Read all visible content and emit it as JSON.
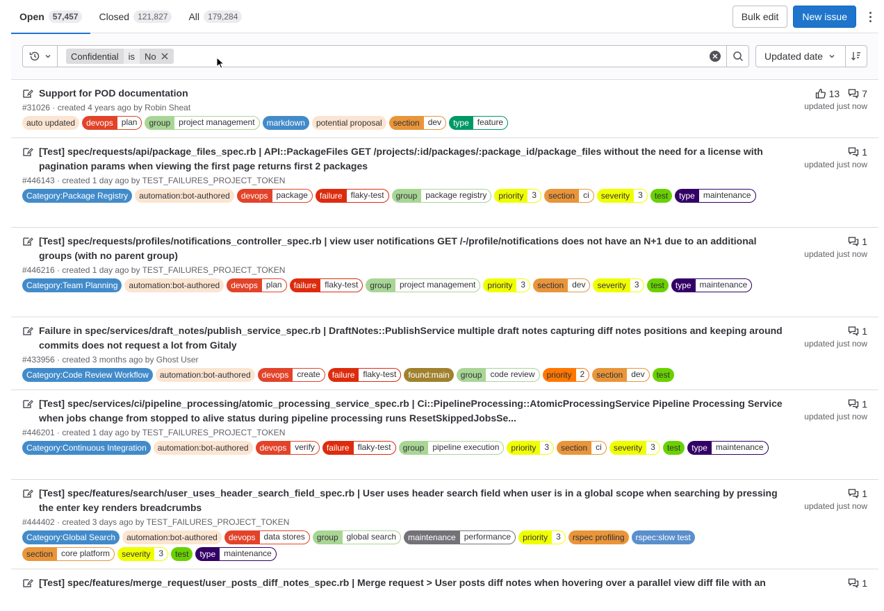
{
  "tabs": [
    {
      "label": "Open",
      "count": "57,457"
    },
    {
      "label": "Closed",
      "count": "121,827"
    },
    {
      "label": "All",
      "count": "179,284"
    }
  ],
  "actions": {
    "bulk_edit": "Bulk edit",
    "new_issue": "New issue"
  },
  "filter": {
    "token_key": "Confidential",
    "token_op": "is",
    "token_value": "No"
  },
  "sort": {
    "label": "Updated date"
  },
  "colors": {
    "accent": "#1f75cb"
  },
  "issues": [
    {
      "title": "Support for POD documentation",
      "meta": "#31026 · created 4 years ago by Robin Sheat",
      "upvotes": "13",
      "comments": "7",
      "updated": "updated just now",
      "labels": [
        {
          "text": "auto updated",
          "bg": "#fbe5d1",
          "fg": "#333238"
        },
        {
          "key": "devops",
          "value": "plan",
          "bg": "#e24329",
          "fg": "#fff"
        },
        {
          "key": "group",
          "value": "project management",
          "bg": "#a8d695",
          "fg": "#333238"
        },
        {
          "text": "markdown",
          "bg": "#428bca",
          "fg": "#fff"
        },
        {
          "text": "potential proposal",
          "bg": "#fbe5d1",
          "fg": "#333238"
        },
        {
          "key": "section",
          "value": "dev",
          "bg": "#e9953a",
          "fg": "#333238"
        },
        {
          "key": "type",
          "value": "feature",
          "bg": "#009966",
          "fg": "#fff"
        }
      ]
    },
    {
      "title": "[Test] spec/requests/api/package_files_spec.rb | API::PackageFiles GET /projects/:id/packages/:package_id/package_files without the need for a license with pagination params when viewing the first page returns first 2 packages",
      "meta": "#446143 · created 1 day ago by TEST_FAILURES_PROJECT_TOKEN",
      "comments": "1",
      "updated": "updated just now",
      "labels": [
        {
          "text": "Category:Package Registry",
          "bg": "#428bca",
          "fg": "#fff"
        },
        {
          "text": "automation:bot-authored",
          "bg": "#fbe5d1",
          "fg": "#333238"
        },
        {
          "key": "devops",
          "value": "package",
          "bg": "#e24329",
          "fg": "#fff"
        },
        {
          "key": "failure",
          "value": "flaky-test",
          "bg": "#dd2b0e",
          "fg": "#fff"
        },
        {
          "key": "group",
          "value": "package registry",
          "bg": "#a8d695",
          "fg": "#333238"
        },
        {
          "key": "priority",
          "value": "3",
          "bg": "#f0ff00",
          "fg": "#333238"
        },
        {
          "key": "section",
          "value": "ci",
          "bg": "#e9953a",
          "fg": "#333238"
        },
        {
          "key": "severity",
          "value": "3",
          "bg": "#f0ff00",
          "fg": "#333238"
        },
        {
          "text": "test",
          "bg": "#69d100",
          "fg": "#333238"
        },
        {
          "key": "type",
          "value": "maintenance",
          "bg": "#330066",
          "fg": "#fff"
        }
      ]
    },
    {
      "title": "[Test] spec/requests/profiles/notifications_controller_spec.rb | view user notifications GET /-/profile/notifications does not have an N+1 due to an additional groups (with no parent group)",
      "meta": "#446216 · created 1 day ago by TEST_FAILURES_PROJECT_TOKEN",
      "comments": "1",
      "updated": "updated just now",
      "labels": [
        {
          "text": "Category:Team Planning",
          "bg": "#428bca",
          "fg": "#fff"
        },
        {
          "text": "automation:bot-authored",
          "bg": "#fbe5d1",
          "fg": "#333238"
        },
        {
          "key": "devops",
          "value": "plan",
          "bg": "#e24329",
          "fg": "#fff"
        },
        {
          "key": "failure",
          "value": "flaky-test",
          "bg": "#dd2b0e",
          "fg": "#fff"
        },
        {
          "key": "group",
          "value": "project management",
          "bg": "#a8d695",
          "fg": "#333238"
        },
        {
          "key": "priority",
          "value": "3",
          "bg": "#f0ff00",
          "fg": "#333238"
        },
        {
          "key": "section",
          "value": "dev",
          "bg": "#e9953a",
          "fg": "#333238"
        },
        {
          "key": "severity",
          "value": "3",
          "bg": "#f0ff00",
          "fg": "#333238"
        },
        {
          "text": "test",
          "bg": "#69d100",
          "fg": "#333238"
        },
        {
          "key": "type",
          "value": "maintenance",
          "bg": "#330066",
          "fg": "#fff"
        }
      ]
    },
    {
      "title": "Failure in spec/services/draft_notes/publish_service_spec.rb | DraftNotes::PublishService multiple draft notes capturing diff notes positions and keeping around commits does not request a lot from Gitaly",
      "meta": "#433956 · created 3 months ago by Ghost User",
      "comments": "1",
      "updated": "updated just now",
      "labels": [
        {
          "text": "Category:Code Review Workflow",
          "bg": "#428bca",
          "fg": "#fff"
        },
        {
          "text": "automation:bot-authored",
          "bg": "#fbe5d1",
          "fg": "#333238"
        },
        {
          "key": "devops",
          "value": "create",
          "bg": "#e24329",
          "fg": "#fff"
        },
        {
          "key": "failure",
          "value": "flaky-test",
          "bg": "#dd2b0e",
          "fg": "#fff"
        },
        {
          "text": "found:main",
          "bg": "#a0812e",
          "fg": "#fff"
        },
        {
          "key": "group",
          "value": "code review",
          "bg": "#a8d695",
          "fg": "#333238"
        },
        {
          "key": "priority",
          "value": "2",
          "bg": "#ff7700",
          "fg": "#333238"
        },
        {
          "key": "section",
          "value": "dev",
          "bg": "#e9953a",
          "fg": "#333238"
        },
        {
          "text": "test",
          "bg": "#69d100",
          "fg": "#333238"
        }
      ]
    },
    {
      "title": "[Test] spec/services/ci/pipeline_processing/atomic_processing_service_spec.rb | Ci::PipelineProcessing::AtomicProcessingService Pipeline Processing Service when jobs change from stopped to alive status during pipeline processing runs ResetSkippedJobsSe...",
      "meta": "#446201 · created 1 day ago by TEST_FAILURES_PROJECT_TOKEN",
      "comments": "1",
      "updated": "updated just now",
      "labels": [
        {
          "text": "Category:Continuous Integration",
          "bg": "#428bca",
          "fg": "#fff"
        },
        {
          "text": "automation:bot-authored",
          "bg": "#fbe5d1",
          "fg": "#333238"
        },
        {
          "key": "devops",
          "value": "verify",
          "bg": "#e24329",
          "fg": "#fff"
        },
        {
          "key": "failure",
          "value": "flaky-test",
          "bg": "#dd2b0e",
          "fg": "#fff"
        },
        {
          "key": "group",
          "value": "pipeline execution",
          "bg": "#a8d695",
          "fg": "#333238"
        },
        {
          "key": "priority",
          "value": "3",
          "bg": "#f0ff00",
          "fg": "#333238"
        },
        {
          "key": "section",
          "value": "ci",
          "bg": "#e9953a",
          "fg": "#333238"
        },
        {
          "key": "severity",
          "value": "3",
          "bg": "#f0ff00",
          "fg": "#333238"
        },
        {
          "text": "test",
          "bg": "#69d100",
          "fg": "#333238"
        },
        {
          "key": "type",
          "value": "maintenance",
          "bg": "#330066",
          "fg": "#fff"
        }
      ]
    },
    {
      "title": "[Test] spec/features/search/user_uses_header_search_field_spec.rb | User uses header search field when user is in a global scope when searching by pressing the enter key renders breadcrumbs",
      "meta": "#444402 · created 3 days ago by TEST_FAILURES_PROJECT_TOKEN",
      "comments": "1",
      "updated": "updated just now",
      "labels": [
        {
          "text": "Category:Global Search",
          "bg": "#428bca",
          "fg": "#fff"
        },
        {
          "text": "automation:bot-authored",
          "bg": "#fbe5d1",
          "fg": "#333238"
        },
        {
          "key": "devops",
          "value": "data stores",
          "bg": "#e24329",
          "fg": "#fff"
        },
        {
          "key": "group",
          "value": "global search",
          "bg": "#a8d695",
          "fg": "#333238"
        },
        {
          "key": "maintenance",
          "value": "performance",
          "bg": "#737278",
          "fg": "#fff"
        },
        {
          "key": "priority",
          "value": "3",
          "bg": "#f0ff00",
          "fg": "#333238"
        },
        {
          "text": "rspec profiling",
          "bg": "#e9953a",
          "fg": "#333238"
        },
        {
          "text": "rspec:slow test",
          "bg": "#5a8fcc",
          "fg": "#fff"
        },
        {
          "key": "section",
          "value": "core platform",
          "bg": "#e9953a",
          "fg": "#333238"
        },
        {
          "key": "severity",
          "value": "3",
          "bg": "#f0ff00",
          "fg": "#333238"
        },
        {
          "text": "test",
          "bg": "#69d100",
          "fg": "#333238"
        },
        {
          "key": "type",
          "value": "maintenance",
          "bg": "#330066",
          "fg": "#fff"
        }
      ]
    },
    {
      "title": "[Test] spec/features/merge_request/user_posts_diff_notes_spec.rb | Merge request > User posts diff notes when hovering over a parallel view diff file with an",
      "meta": "",
      "comments": "1",
      "updated": "",
      "labels": []
    }
  ]
}
